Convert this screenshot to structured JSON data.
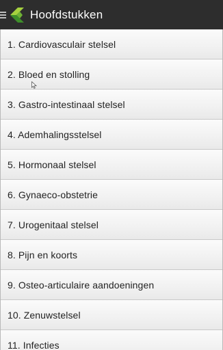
{
  "header": {
    "title": "Hoofdstukken",
    "menu_icon": "hamburger-menu-icon",
    "logo_icon": "app-logo-icon",
    "colors": {
      "bar": "#2d2d2d",
      "logo_green_light": "#9ccc3c",
      "logo_green_dark": "#3e8f2a"
    }
  },
  "chapters": [
    {
      "label": "1. Cardiovasculair stelsel"
    },
    {
      "label": "2. Bloed en stolling"
    },
    {
      "label": "3. Gastro-intestinaal stelsel"
    },
    {
      "label": "4. Ademhalingsstelsel"
    },
    {
      "label": "5. Hormonaal stelsel"
    },
    {
      "label": "6. Gynaeco-obstetrie"
    },
    {
      "label": "7. Urogenitaal stelsel"
    },
    {
      "label": "8. Pijn en koorts"
    },
    {
      "label": "9. Osteo-articulaire aandoeningen"
    },
    {
      "label": "10. Zenuwstelsel"
    },
    {
      "label": "11. Infecties"
    }
  ]
}
